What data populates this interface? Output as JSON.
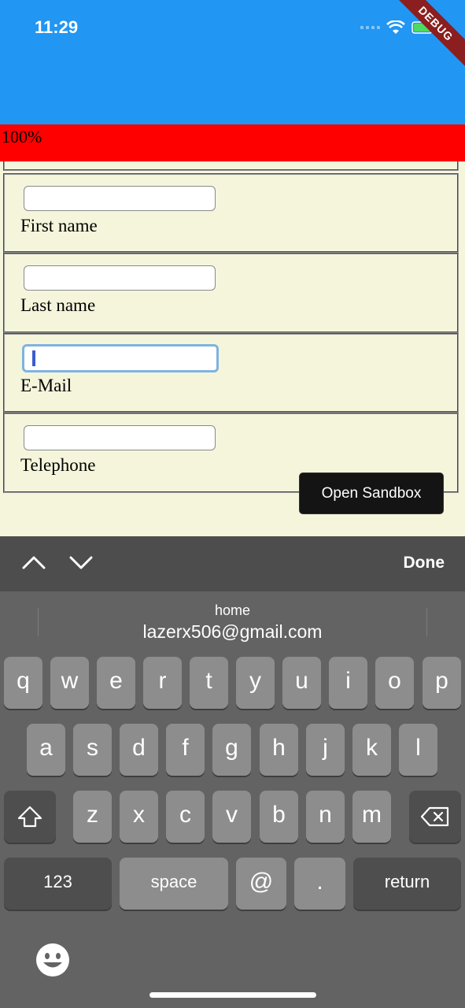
{
  "status_bar": {
    "time": "11:29"
  },
  "debug_banner": "DEBUG",
  "progress": {
    "label": "100%",
    "value": 1.0,
    "color": "#ff0000"
  },
  "form": {
    "fields": [
      {
        "label": "First name",
        "value": ""
      },
      {
        "label": "Last name",
        "value": ""
      },
      {
        "label": "E-Mail",
        "value": ""
      },
      {
        "label": "Telephone",
        "value": ""
      }
    ]
  },
  "sandbox_button": "Open Sandbox",
  "accessory_bar": {
    "done_label": "Done"
  },
  "keyboard": {
    "suggestion": {
      "label": "home",
      "value": "lazerx506@gmail.com"
    },
    "row1": [
      "q",
      "w",
      "e",
      "r",
      "t",
      "y",
      "u",
      "i",
      "o",
      "p"
    ],
    "row2": [
      "a",
      "s",
      "d",
      "f",
      "g",
      "h",
      "j",
      "k",
      "l"
    ],
    "row3": [
      "z",
      "x",
      "c",
      "v",
      "b",
      "n",
      "m"
    ],
    "row4": {
      "numbers": "123",
      "space": "space",
      "at": "@",
      "dot": ".",
      "return": "return"
    }
  },
  "colors": {
    "app_bar": "#2196F3",
    "form_background": "#f5f5dc",
    "keyboard": "#636363"
  }
}
